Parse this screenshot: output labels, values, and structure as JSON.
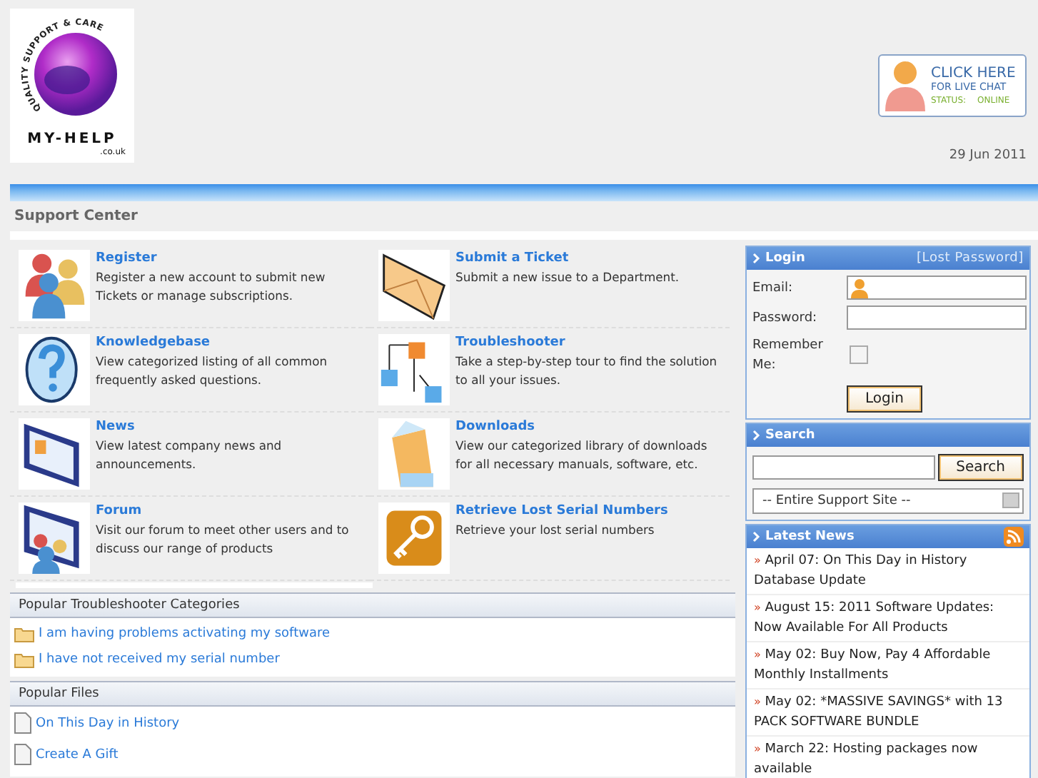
{
  "logo": {
    "arc_text": "QUALITY SUPPORT & CARE",
    "name": "MY-HELP",
    "domain": ".co.uk"
  },
  "live_chat": {
    "line_1": "CLICK HERE",
    "line_2": "FOR LIVE CHAT",
    "status_label": "STATUS:",
    "status": "ONLINE"
  },
  "date": "29 Jun 2011",
  "page_title": "Support Center",
  "features": [
    {
      "kind": "people",
      "title": "Register",
      "description": "Register a new account to submit new Tickets or manage subscriptions."
    },
    {
      "kind": "envelope",
      "title": "Submit a Ticket",
      "description": "Submit a new issue to a Department."
    },
    {
      "kind": "question",
      "title": "Knowledgebase",
      "description": "View categorized listing of all common frequently asked questions."
    },
    {
      "kind": "cubes",
      "title": "Troubleshooter",
      "description": "Take a step-by-step tour to find the solution to all your issues."
    },
    {
      "kind": "news",
      "title": "News",
      "description": "View latest company news and announcements."
    },
    {
      "kind": "box",
      "title": "Downloads",
      "description": "View our categorized library of downloads for all necessary manuals, software, etc."
    },
    {
      "kind": "forum",
      "title": "Forum",
      "description": "Visit our forum to meet other users and to discuss our range of products"
    },
    {
      "kind": "key",
      "title": "Retrieve Lost Serial Numbers",
      "description": "Retrieve your lost serial numbers"
    }
  ],
  "troubleshooter_categories": {
    "title": "Popular Troubleshooter Categories",
    "items": [
      "I am having problems activating my software",
      "I have not received my serial number"
    ]
  },
  "popular_files": {
    "title": "Popular Files",
    "items": [
      "On This Day in History",
      "Create A Gift"
    ]
  },
  "login": {
    "title": "Login",
    "lost_password": "[Lost Password]",
    "email_label": "Email:",
    "password_label": "Password:",
    "remember_label": "Remember Me:",
    "remember_checked": false,
    "button": "Login"
  },
  "search": {
    "title": "Search",
    "button": "Search",
    "scope": "-- Entire Support Site --"
  },
  "latest_news": {
    "title": "Latest News",
    "marker": "»",
    "items": [
      "April 07: On This Day in History Database Update",
      "August 15: 2011 Software Updates: Now Available For All Products",
      "May 02: Buy Now, Pay 4 Affordable Monthly Installments",
      "May 02: *MASSIVE SAVINGS* with 13 PACK SOFTWARE BUNDLE",
      "March 22: Hosting packages now available"
    ]
  }
}
